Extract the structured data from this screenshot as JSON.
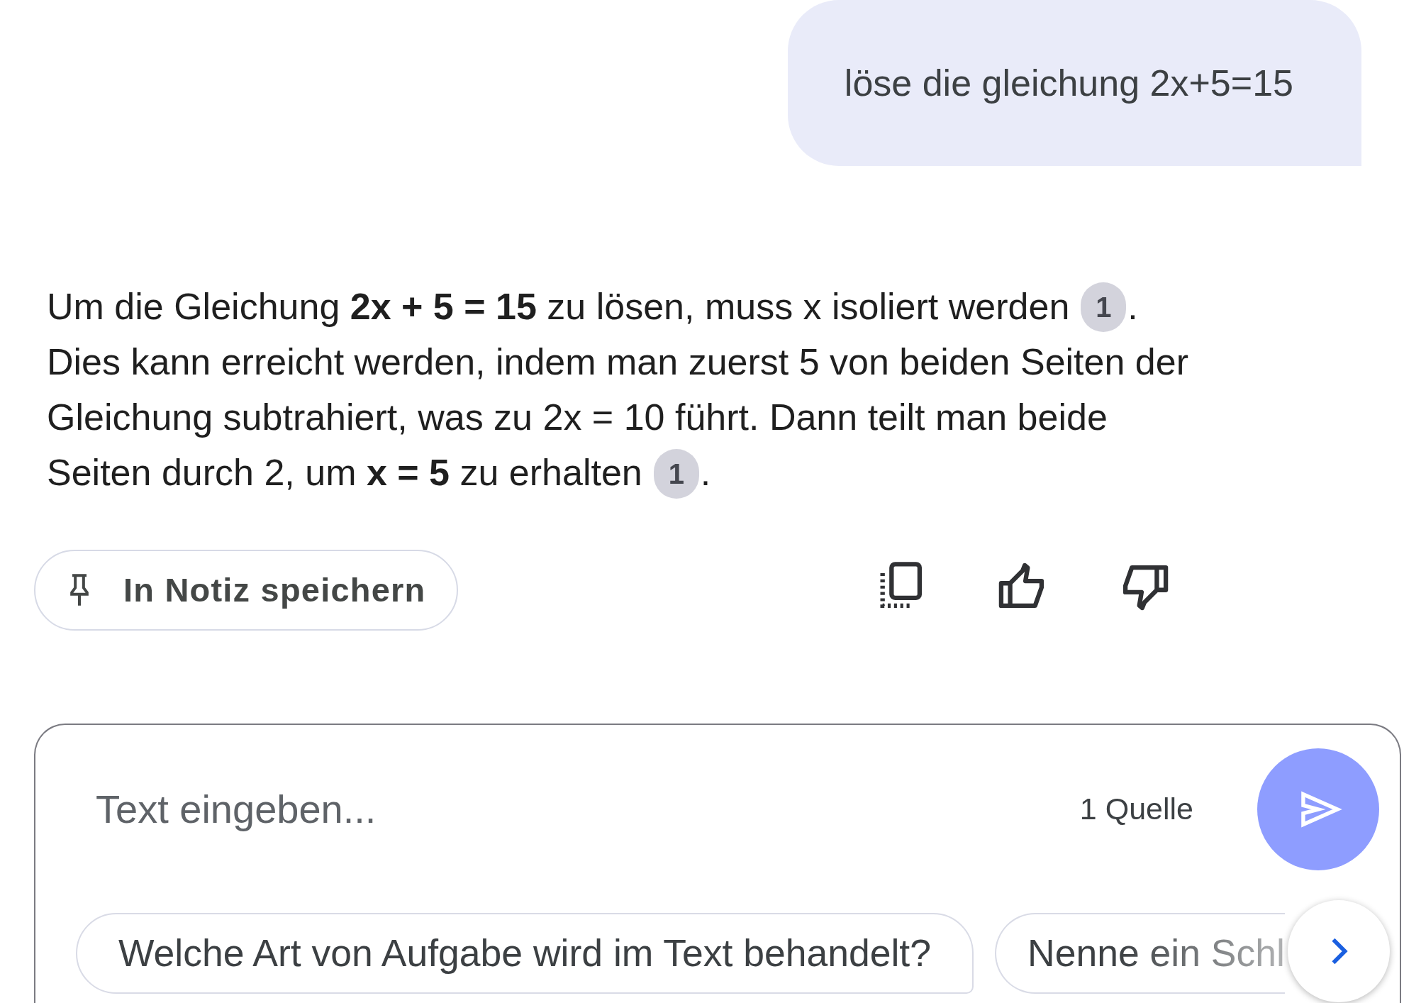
{
  "user_message": {
    "text": "löse die gleichung 2x+5=15"
  },
  "answer": {
    "segments": [
      {
        "kind": "text",
        "text": "Um die Gleichung **2x + 5 = 15** zu lösen, muss x isoliert werden"
      },
      {
        "kind": "citation",
        "label": "1"
      },
      {
        "kind": "text",
        "text": ". Dies kann erreicht werden, indem man zuerst 5 von beiden Seiten der Gleichung subtrahiert, was zu 2x = 10 führt. Dann teilt man beide Seiten durch 2, um **x = 5** zu erhalten"
      },
      {
        "kind": "citation",
        "label": "1"
      },
      {
        "kind": "text",
        "text": "."
      }
    ]
  },
  "actions": {
    "save_note": {
      "label": "In Notiz speichern"
    }
  },
  "composer": {
    "placeholder": "Text eingeben...",
    "source_count": "1 Quelle",
    "suggestions": [
      {
        "text": "Welche Art von Aufgabe wird im Text behandelt?"
      },
      {
        "text": "Nenne ein Schl"
      }
    ]
  }
}
